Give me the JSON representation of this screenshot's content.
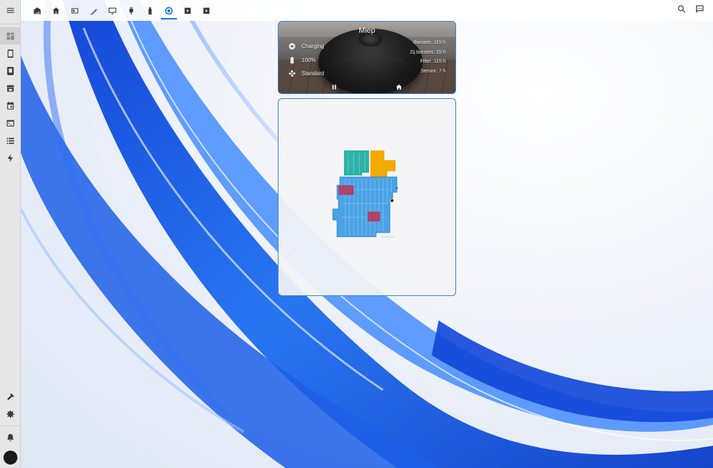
{
  "sidebar": {
    "items": [
      {
        "name": "sidebar-item-menu",
        "icon": "menu-icon"
      },
      {
        "name": "sidebar-item-overview",
        "icon": "dashboard-icon"
      },
      {
        "name": "sidebar-item-phone",
        "icon": "phone-icon"
      },
      {
        "name": "sidebar-item-tablet",
        "icon": "tablet-icon"
      },
      {
        "name": "sidebar-item-shop",
        "icon": "store-icon"
      },
      {
        "name": "sidebar-item-calendar",
        "icon": "calendar-icon"
      },
      {
        "name": "sidebar-item-terminal",
        "icon": "terminal-icon"
      },
      {
        "name": "sidebar-item-list",
        "icon": "list-icon"
      },
      {
        "name": "sidebar-item-energy",
        "icon": "lightning-icon"
      }
    ],
    "bottom": [
      {
        "name": "sidebar-item-tools",
        "icon": "hammer-icon"
      },
      {
        "name": "sidebar-item-settings",
        "icon": "gear-icon"
      },
      {
        "name": "sidebar-item-notifications",
        "icon": "bell-icon"
      }
    ]
  },
  "topbar": {
    "tabs": [
      "home-chart-icon",
      "house-icon",
      "device-icon",
      "stairs-icon",
      "monitor-icon",
      "plug-icon",
      "bottle-icon",
      "vacuum-icon",
      "chevron-right-icon",
      "chevron-right-icon"
    ],
    "active_tab": 7,
    "right": [
      "search-icon",
      "assist-icon"
    ]
  },
  "vacuum": {
    "name": "Miep",
    "status": "Charging",
    "battery": "100%",
    "fan_mode": "Standard",
    "stats": {
      "brushes": "Borstels: 115 h",
      "side_brushes": "Zij borstels: 15 h",
      "filter": "Filter: 115 h",
      "sensor": "Sensor: 7 h"
    }
  },
  "colors": {
    "accent": "#1e6fd9",
    "map_floor": "#4aa3e6",
    "map_room_teal": "#2bb3a6",
    "map_room_orange": "#f2a900",
    "map_zone": "#b0436b"
  }
}
